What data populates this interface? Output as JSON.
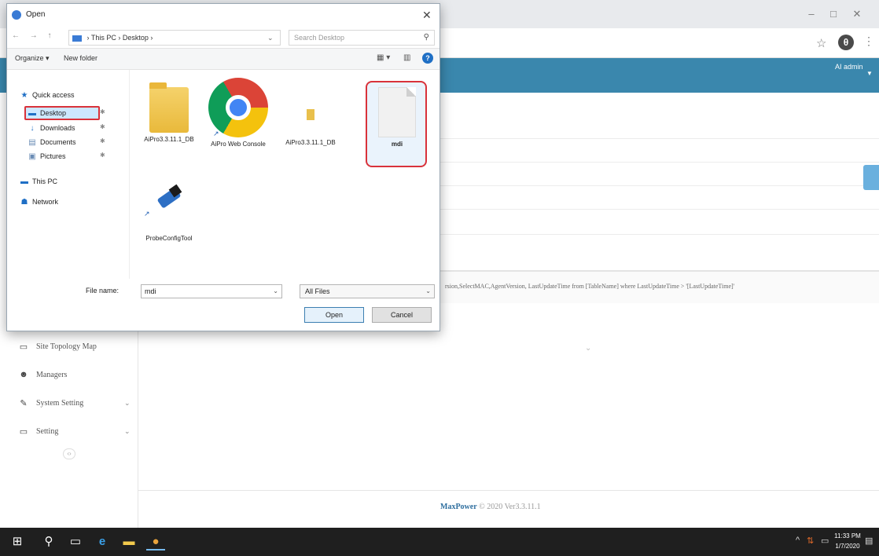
{
  "dialog": {
    "title": "Open",
    "breadcrumb": "›  This PC  ›  Desktop  ›",
    "search_placeholder": "Search Desktop",
    "organize_label": "Organize ▾",
    "new_folder_label": "New folder",
    "nav_pane": {
      "quick_access": "Quick access",
      "items": [
        {
          "label": "Desktop",
          "selected": true
        },
        {
          "label": "Downloads"
        },
        {
          "label": "Documents"
        },
        {
          "label": "Pictures"
        }
      ],
      "this_pc": "This PC",
      "network": "Network"
    },
    "files": [
      {
        "name": "AiPro3.3.11.1_DB",
        "type": "folder"
      },
      {
        "name": "AiPro Web Console",
        "type": "shortcut"
      },
      {
        "name": "AiPro3.3.11.1_DB",
        "type": "folder"
      },
      {
        "name": "mdi",
        "type": "file",
        "selected": true
      },
      {
        "name": "ProbeConfigTool",
        "type": "shortcut"
      }
    ],
    "file_name_label": "File name:",
    "file_name_value": "mdi",
    "filter_value": "All Files",
    "open_label": "Open",
    "cancel_label": "Cancel"
  },
  "app": {
    "user_menu": "AI admin",
    "query_text": "rsion,SelectMAC,AgentVersion, LastUpdateTime from [TableName] where LastUpdateTime > '[LastUpdateTime]'",
    "sidebar": [
      {
        "label": "Site Topology Map",
        "icon": "monitor-icon"
      },
      {
        "label": "Managers",
        "icon": "users-icon"
      },
      {
        "label": "System Setting",
        "icon": "edit-icon",
        "has_caret": true
      },
      {
        "label": "Setting",
        "icon": "screen-icon",
        "has_caret": true
      }
    ],
    "footer_brand": "MaxPower",
    "footer_rest": "© 2020 Ver3.3.11.1"
  },
  "taskbar": {
    "time": "11:33 PM",
    "date": "1/7/2020"
  },
  "colors": {
    "header_blue": "#3a87ad",
    "highlight_red": "#d9323a",
    "taskbar": "#1f1f1f"
  }
}
